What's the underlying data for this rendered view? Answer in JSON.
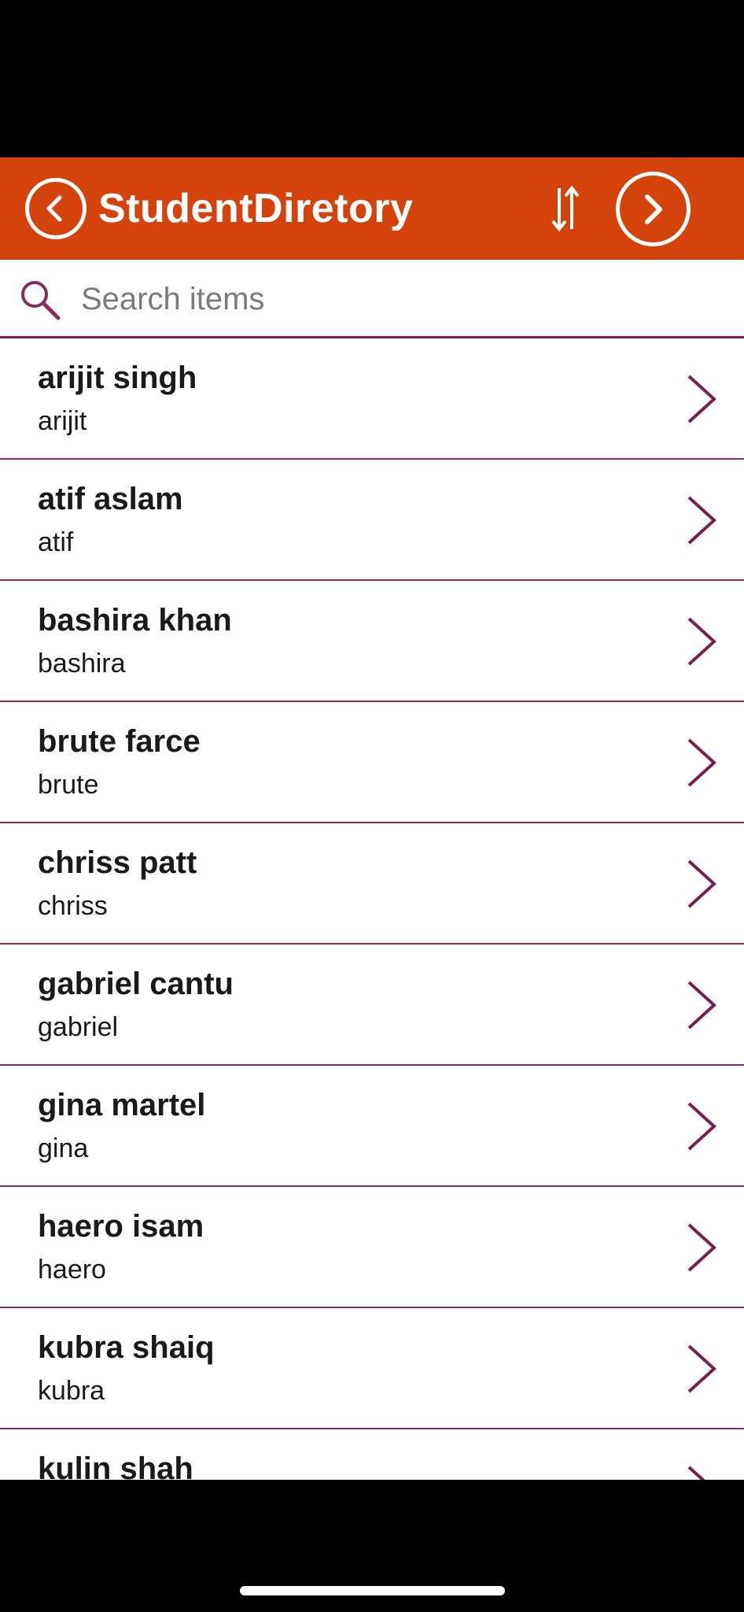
{
  "header": {
    "title": "StudentDiretory",
    "back_icon": "chevron-left-circle-icon",
    "sort_icon": "sort-arrows-icon",
    "next_icon": "chevron-right-circle-icon",
    "background_color": "#d4430c"
  },
  "search": {
    "placeholder": "Search items",
    "value": "",
    "icon": "search-icon"
  },
  "list": {
    "items": [
      {
        "title": "arijit singh",
        "subtitle": "arijit"
      },
      {
        "title": "atif aslam",
        "subtitle": "atif"
      },
      {
        "title": "bashira khan",
        "subtitle": "bashira"
      },
      {
        "title": "brute farce",
        "subtitle": "brute"
      },
      {
        "title": "chriss patt",
        "subtitle": "chriss"
      },
      {
        "title": "gabriel cantu",
        "subtitle": "gabriel"
      },
      {
        "title": "gina martel",
        "subtitle": "gina"
      },
      {
        "title": "haero isam",
        "subtitle": "haero"
      },
      {
        "title": "kubra shaiq",
        "subtitle": "kubra"
      },
      {
        "title": "kulin shah",
        "subtitle": ""
      }
    ],
    "separator_color": "#8a2a5a",
    "chevron_icon": "chevron-right-icon"
  }
}
